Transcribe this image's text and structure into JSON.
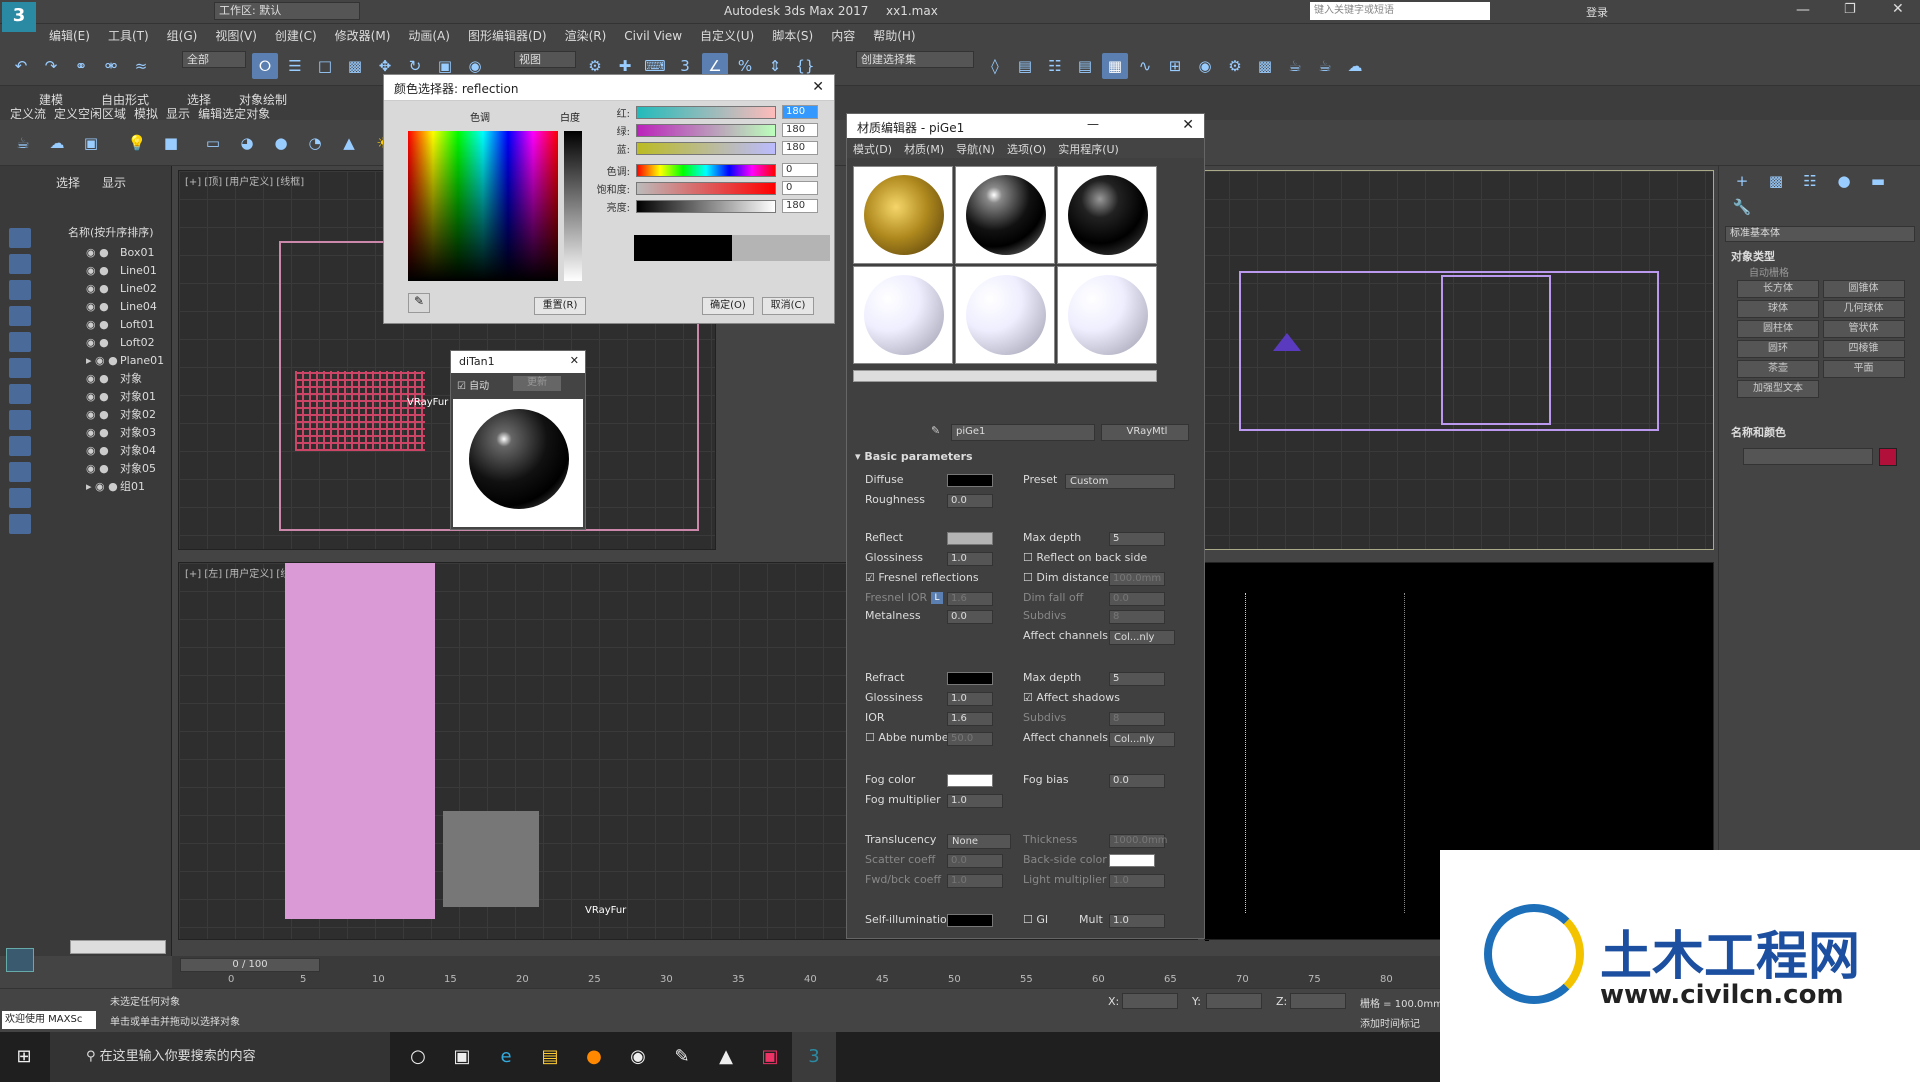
{
  "titlebar": {
    "app_title": "Autodesk 3ds Max 2017",
    "file": "xx1.max",
    "workspace": "工作区: 默认",
    "search_placeholder": "键入关键字或短语",
    "login": "登录"
  },
  "menu": [
    "编辑(E)",
    "工具(T)",
    "组(G)",
    "视图(V)",
    "创建(C)",
    "修改器(M)",
    "动画(A)",
    "图形编辑器(D)",
    "渲染(R)",
    "Civil View",
    "自定义(U)",
    "脚本(S)",
    "内容",
    "帮助(H)"
  ],
  "toolbar": {
    "filter": "全部",
    "view": "视图",
    "selection_set": "创建选择集"
  },
  "ribbon": {
    "tabs": [
      "建模",
      "自由形式",
      "选择",
      "对象绘制"
    ],
    "sub": [
      "定义流",
      "定义空闲区域",
      "模拟",
      "显示",
      "编辑选定对象"
    ]
  },
  "scene_explorer": {
    "tabs": [
      "选择",
      "显示"
    ],
    "header": "名称(按升序排序)",
    "items": [
      "Box01",
      "Line01",
      "Line02",
      "Line04",
      "Loft01",
      "Loft02",
      "Plane01",
      "对象",
      "对象01",
      "对象02",
      "对象03",
      "对象04",
      "对象05",
      "组01"
    ]
  },
  "viewports": {
    "top_label": "[+] [顶] [用户定义] [线框]",
    "left_label": "[+] [左] [用户定义] [线框]",
    "fur_label": "VRayFur"
  },
  "color_picker": {
    "title": "颜色选择器: reflection",
    "hue_label": "色调",
    "white_label": "白度",
    "channels": [
      {
        "label": "红:",
        "value": "180"
      },
      {
        "label": "绿:",
        "value": "180"
      },
      {
        "label": "蓝:",
        "value": "180"
      },
      {
        "label": "色调:",
        "value": "0"
      },
      {
        "label": "饱和度:",
        "value": "0"
      },
      {
        "label": "亮度:",
        "value": "180"
      }
    ],
    "reset": "重置(R)",
    "ok": "确定(O)",
    "cancel": "取消(C)"
  },
  "ditan": {
    "title": "diTan1",
    "auto": "自动",
    "update": "更新"
  },
  "material_editor": {
    "title": "材质编辑器 - piGe1",
    "menu": [
      "模式(D)",
      "材质(M)",
      "导航(N)",
      "选项(O)",
      "实用程序(U)"
    ],
    "material_name": "piGe1",
    "material_type": "VRayMtl",
    "rollout": "Basic parameters",
    "params": {
      "diffuse": "Diffuse",
      "preset": "Preset",
      "preset_value": "Custom",
      "roughness": "Roughness",
      "roughness_value": "0.0",
      "reflect": "Reflect",
      "max_depth": "Max depth",
      "max_depth_value": "5",
      "glossiness": "Glossiness",
      "glossiness_value": "1.0",
      "reflect_back": "Reflect on back side",
      "fresnel": "Fresnel reflections",
      "dim_distance": "Dim distance",
      "dim_distance_value": "100.0mm",
      "fresnel_ior": "Fresnel IOR",
      "fresnel_ior_lock": "L",
      "fresnel_ior_value": "1.6",
      "dim_falloff": "Dim fall off",
      "dim_falloff_value": "0.0",
      "subdivs": "Subdivs",
      "subdivs_value": "8",
      "metalness": "Metalness",
      "metalness_value": "0.0",
      "affect_channels": "Affect channels",
      "affect_value": "Col...nly",
      "refract": "Refract",
      "refract_max_depth_value": "5",
      "refract_gloss_value": "1.0",
      "affect_shadows": "Affect shadows",
      "ior": "IOR",
      "ior_value": "1.6",
      "refract_subdivs_value": "8",
      "abbe": "Abbe number",
      "abbe_value": "50.0",
      "fog_color": "Fog color",
      "fog_bias": "Fog bias",
      "fog_bias_value": "0.0",
      "fog_mult": "Fog multiplier",
      "fog_mult_value": "1.0",
      "translucency": "Translucency",
      "translucency_value": "None",
      "thickness": "Thickness",
      "thickness_value": "1000.0mm",
      "scatter": "Scatter coeff",
      "scatter_value": "0.0",
      "backside": "Back-side color",
      "fwdbck": "Fwd/bck coeff",
      "fwdbck_value": "1.0",
      "light_mult": "Light multiplier",
      "light_mult_value": "1.0",
      "selfillum": "Self-illumination",
      "gi": "GI",
      "mult": "Mult",
      "mult_value": "1.0"
    }
  },
  "command_panel": {
    "category": "标准基本体",
    "object_type": "对象类型",
    "autogrid": "自动栅格",
    "buttons": [
      "长方体",
      "圆锥体",
      "球体",
      "几何球体",
      "圆柱体",
      "管状体",
      "圆环",
      "四棱锥",
      "茶壶",
      "平面",
      "加强型文本"
    ],
    "name_color": "名称和颜色",
    "swatch": "#b0103a"
  },
  "timeline": {
    "frame": "0 / 100",
    "ticks": [
      "0",
      "5",
      "10",
      "15",
      "20",
      "25",
      "30",
      "35",
      "40",
      "45",
      "50",
      "55",
      "60",
      "65",
      "70",
      "75",
      "80"
    ]
  },
  "status": {
    "welcome": "欢迎使用 MAXSc",
    "msg1": "未选定任何对象",
    "msg2": "单击或单击并拖动以选择对象",
    "x": "X:",
    "y": "Y:",
    "z": "Z:",
    "grid": "栅格 = 100.0mm",
    "add_key": "添加时间标记"
  },
  "taskbar": {
    "search": "在这里输入你要搜索的内容"
  },
  "watermark": {
    "name": "土木工程网",
    "url": "www.civilcn.com"
  }
}
